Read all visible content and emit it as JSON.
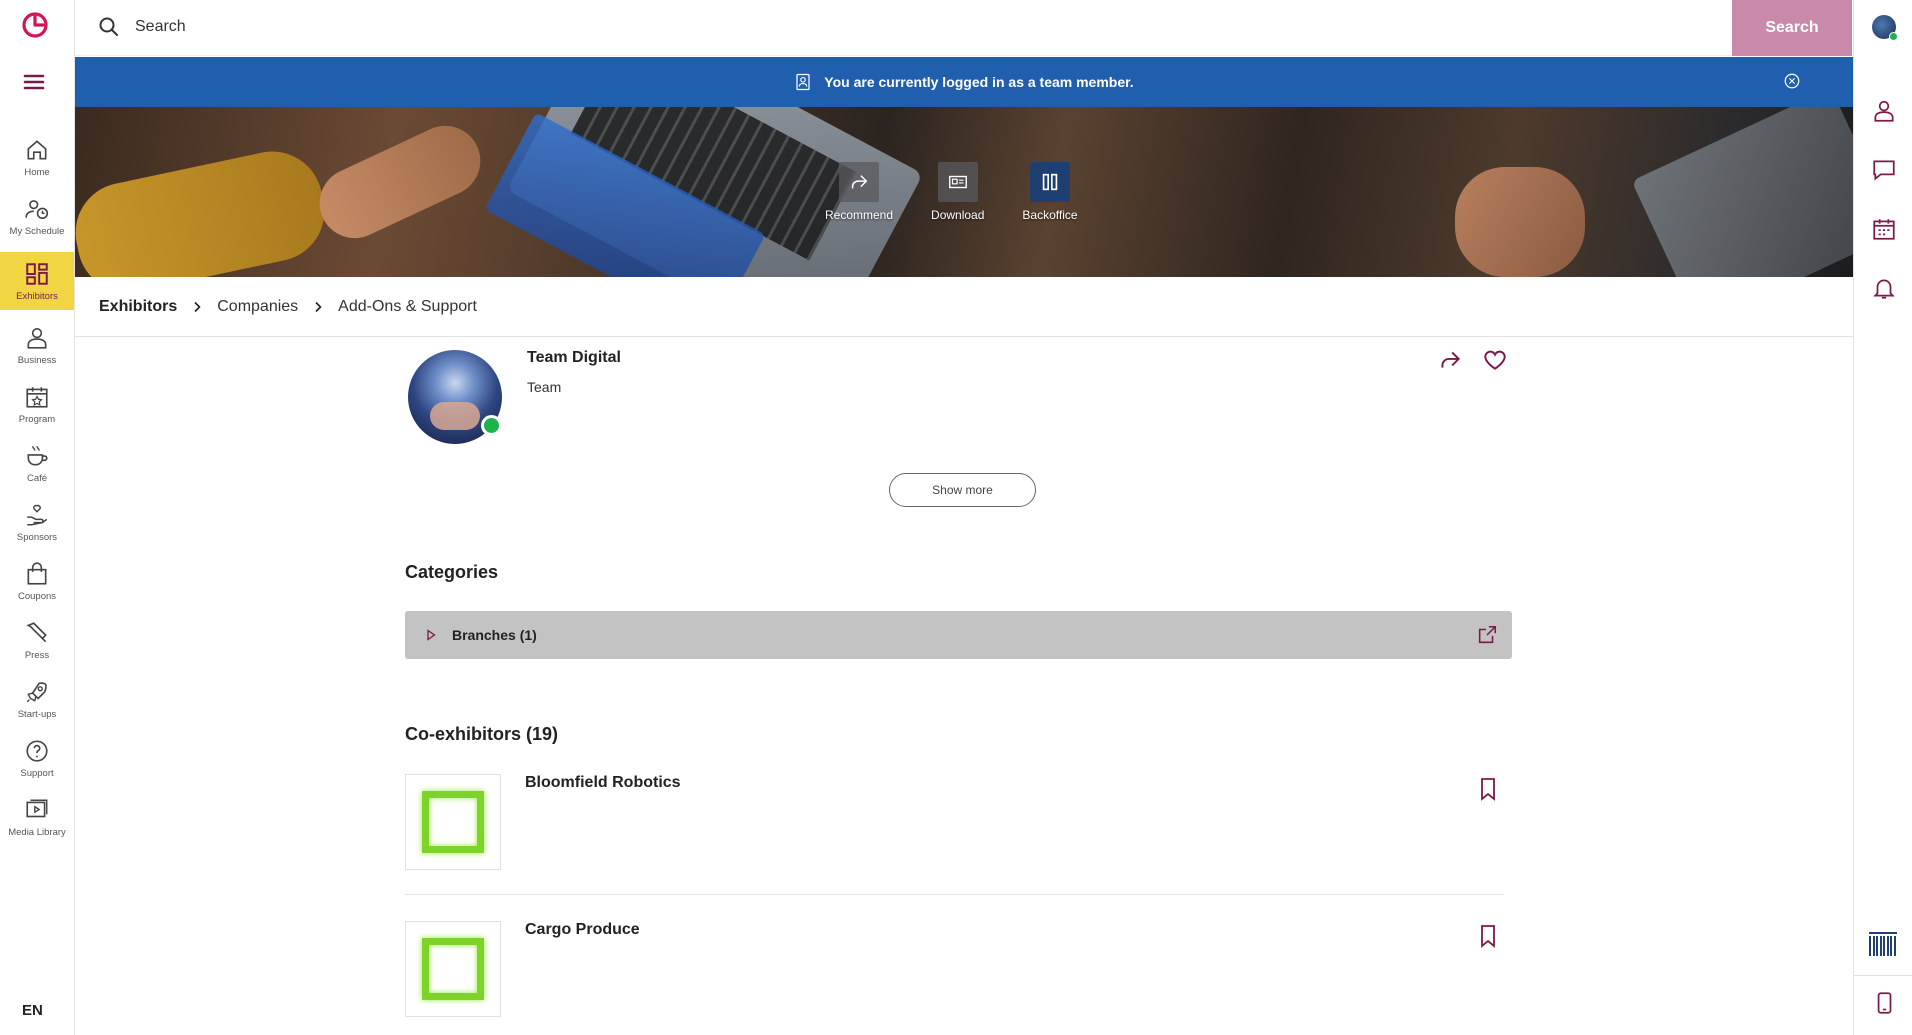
{
  "search": {
    "placeholder": "Search",
    "button_label": "Search"
  },
  "notice": {
    "text": "You are currently logged in as a team member."
  },
  "nav": {
    "items": [
      {
        "label": "Home",
        "icon": "home-icon"
      },
      {
        "label": "My Schedule",
        "icon": "schedule-icon"
      },
      {
        "label": "Exhibitors",
        "icon": "grid-icon",
        "active": true
      },
      {
        "label": "Business",
        "icon": "person-icon"
      },
      {
        "label": "Program",
        "icon": "calendar-star-icon"
      },
      {
        "label": "Café",
        "icon": "coffee-icon"
      },
      {
        "label": "Sponsors",
        "icon": "hand-heart-icon"
      },
      {
        "label": "Coupons",
        "icon": "shopping-bag-icon"
      },
      {
        "label": "Press",
        "icon": "pen-icon"
      },
      {
        "label": "Start-ups",
        "icon": "rocket-icon"
      },
      {
        "label": "Support",
        "icon": "help-icon"
      },
      {
        "label": "Media Library",
        "icon": "media-icon"
      }
    ],
    "language": "EN"
  },
  "hero": {
    "actions": [
      {
        "label": "Recommend",
        "icon": "share-arrow-icon"
      },
      {
        "label": "Download",
        "icon": "vcard-icon"
      },
      {
        "label": "Backoffice",
        "icon": "columns-icon"
      }
    ]
  },
  "breadcrumb": {
    "items": [
      "Exhibitors",
      "Companies",
      "Add-Ons & Support"
    ]
  },
  "profile": {
    "name": "Team Digital",
    "type": "Team",
    "show_more_label": "Show more"
  },
  "categories": {
    "title": "Categories",
    "items": [
      {
        "label": "Branches (1)"
      }
    ]
  },
  "co_exhibitors": {
    "title": "Co-exhibitors (19)",
    "items": [
      {
        "name": "Bloomfield Robotics"
      },
      {
        "name": "Cargo Produce"
      }
    ]
  },
  "colors": {
    "accent": "#7a1a4a",
    "notice_blue": "#1f5fae",
    "active_nav": "#f2d542",
    "search_button": "#c88aa8",
    "logo_green": "#7dd32a",
    "online": "#1db34a"
  }
}
